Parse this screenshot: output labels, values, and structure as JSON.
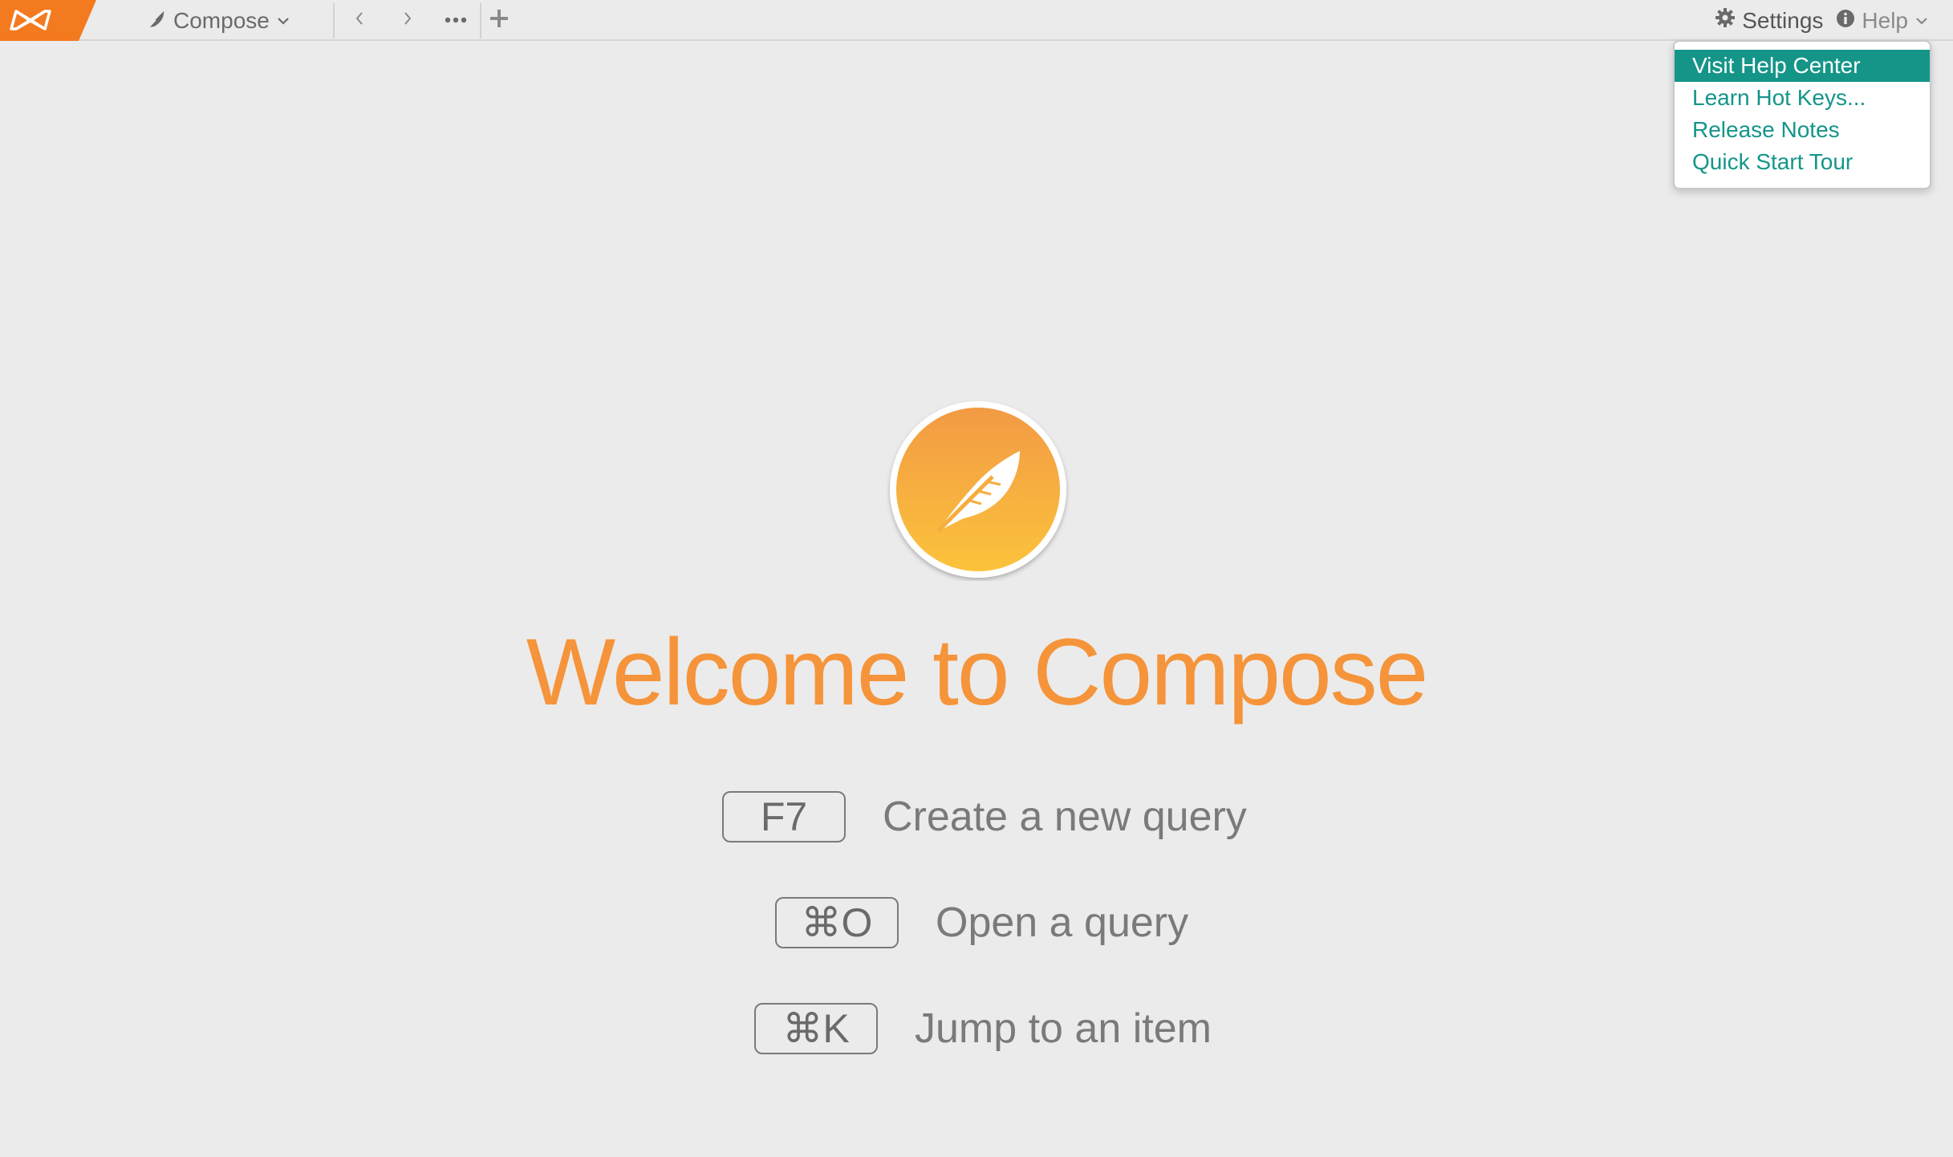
{
  "topbar": {
    "compose_label": "Compose",
    "settings_label": "Settings",
    "help_label": "Help"
  },
  "help_menu": {
    "items": [
      {
        "label": "Visit Help Center"
      },
      {
        "label": "Learn Hot Keys..."
      },
      {
        "label": "Release Notes"
      },
      {
        "label": "Quick Start Tour"
      }
    ]
  },
  "main": {
    "title": "Welcome to Compose",
    "shortcuts": [
      {
        "key": "F7",
        "label": "Create a new query"
      },
      {
        "key": "⌘O",
        "label": "Open a query"
      },
      {
        "key": "⌘K",
        "label": "Jump to an item"
      }
    ]
  },
  "colors": {
    "brand_orange": "#f5943a",
    "accent_teal": "#149588",
    "background": "#ebebeb"
  },
  "icons": {
    "logo": "app-logo-icon",
    "compose": "feather-icon",
    "back": "chevron-left-icon",
    "forward": "chevron-right-icon",
    "more": "ellipsis-icon",
    "add": "plus-icon",
    "settings": "gear-icon",
    "help": "info-icon"
  }
}
